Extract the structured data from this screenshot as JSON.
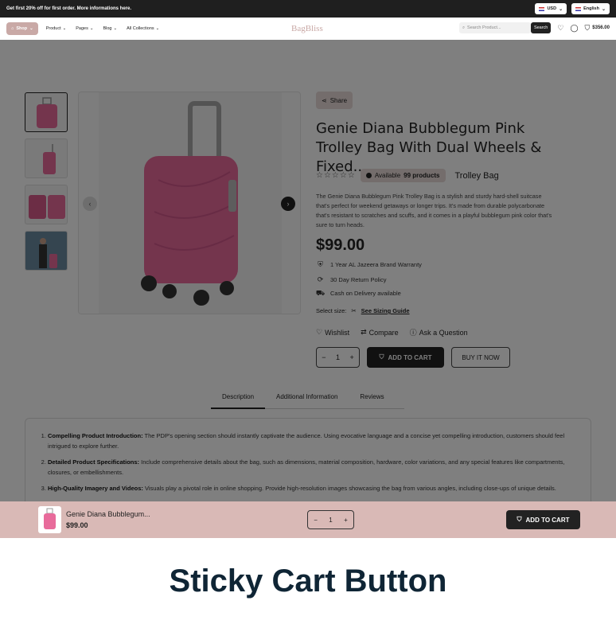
{
  "topbar": {
    "announcement": "Get first 20% off for first order. More informations here.",
    "currency": "USD",
    "language": "English"
  },
  "nav": {
    "shop_label": "Shop",
    "links": [
      "Product",
      "Pages",
      "Blog",
      "All Collections"
    ],
    "logo": "BagBliss",
    "search_placeholder": "Search Product...",
    "search_button": "Search",
    "cart_total": "$356.00"
  },
  "product": {
    "share": "Share",
    "title": "Genie Diana Bubblegum Pink Trolley Bag With Dual Wheels & Fixed...",
    "availability_prefix": "Available",
    "availability_count": "99 products",
    "category": "Trolley Bag",
    "description": "The Genie Diana Bubblegum Pink Trolley Bag is a stylish and sturdy hard-shell suitcase that's perfect for weekend getaways or longer trips. It's made from durable polycarbonate that's resistant to scratches and scuffs, and it comes in a playful bubblegum pink color that's sure to turn heads.",
    "price": "$99.00",
    "features": [
      "1 Year AL Jazeera Brand Warranty",
      "30 Day Return Policy",
      "Cash on Delivery available"
    ],
    "size_label": "Select size:",
    "sizing_guide": "See Sizing Guide",
    "wishlist": "Wishlist",
    "compare": "Compare",
    "ask": "Ask a Question",
    "quantity": "1",
    "add_to_cart": "ADD TO CART",
    "buy_now": "BUY IT NOW"
  },
  "tabs": [
    "Description",
    "Additional Information",
    "Reviews"
  ],
  "description_list": [
    {
      "heading": "Compelling Product Introduction:",
      "text": "The PDP's opening section should instantly captivate the audience. Using evocative language and a concise yet compelling introduction, customers should feel intrigued to explore further."
    },
    {
      "heading": "Detailed Product Specifications:",
      "text": "Include comprehensive details about the bag, such as dimensions, material composition, hardware, color variations, and any special features like compartments, closures, or embellishments."
    },
    {
      "heading": "High-Quality Imagery and Videos:",
      "text": "Visuals play a pivotal role in online shopping. Provide high-resolution images showcasing the bag from various angles, including close-ups of unique details."
    }
  ],
  "sticky": {
    "name": "Genie Diana Bubblegum...",
    "price": "$99.00",
    "quantity": "1",
    "add_to_cart": "ADD TO CART"
  },
  "caption": "Sticky Cart Button",
  "colors": {
    "accent": "#c9a9a6",
    "sticky_bg": "#d9b9b6",
    "dark": "#222222",
    "caption": "#0f2535",
    "bag_pink": "#e86b9b"
  }
}
